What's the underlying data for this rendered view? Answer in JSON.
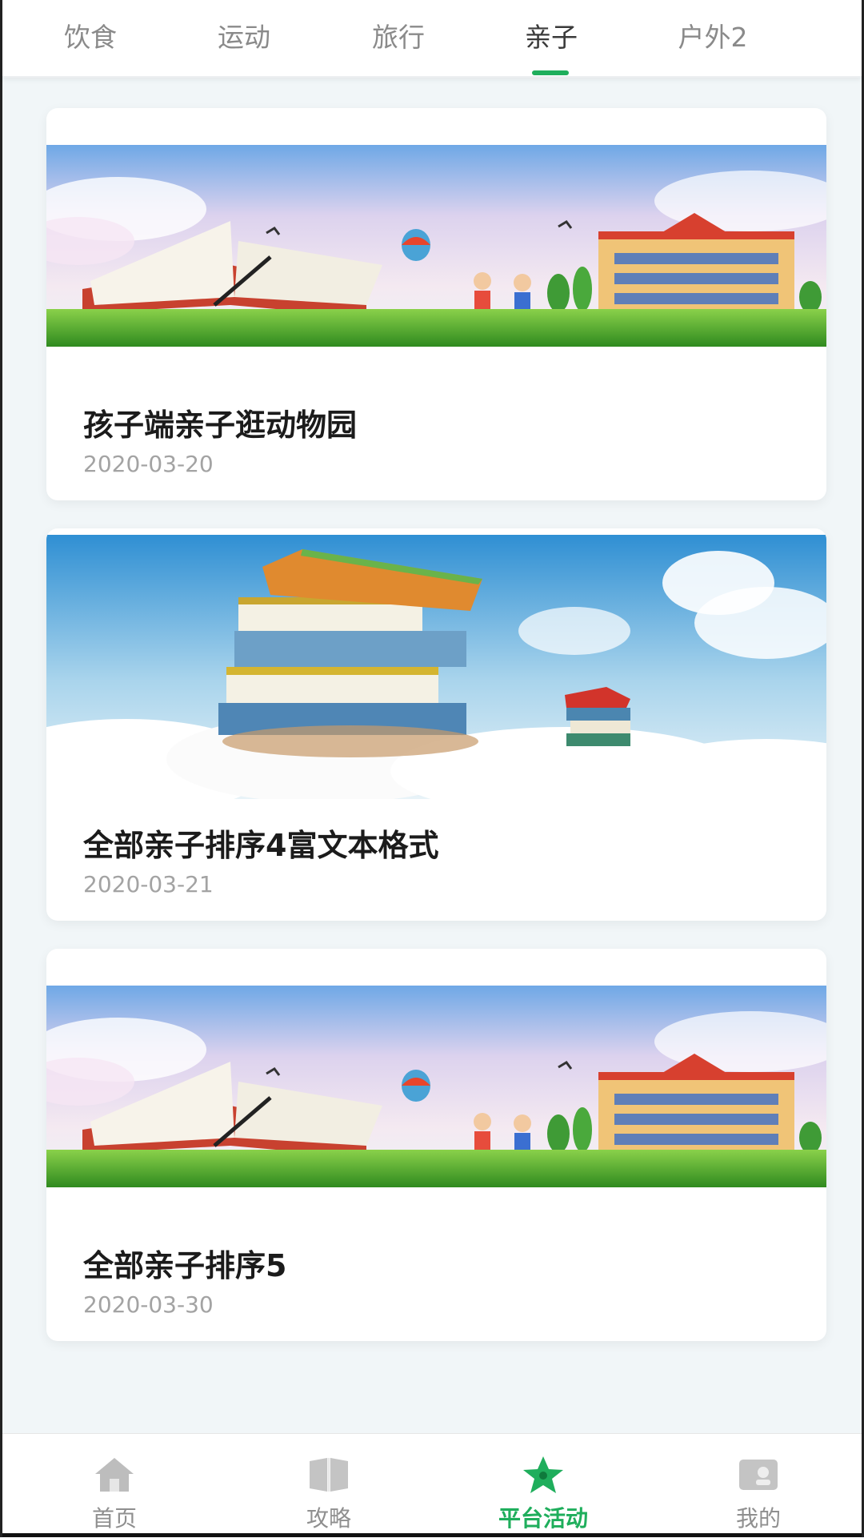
{
  "tabs": [
    {
      "label": "饮食"
    },
    {
      "label": "运动"
    },
    {
      "label": "旅行"
    },
    {
      "label": "亲子"
    },
    {
      "label": "户外2"
    }
  ],
  "active_tab": "亲子",
  "cards": [
    {
      "title": "孩子端亲子逛动物园",
      "date": "2020-03-20",
      "image": "school-meadow-banner"
    },
    {
      "title": "全部亲子排序4富文本格式",
      "date": "2020-03-21",
      "image": "book-stack-sky-banner"
    },
    {
      "title": "全部亲子排序5",
      "date": "2020-03-30",
      "image": "school-meadow-banner"
    }
  ],
  "bottom_nav": [
    {
      "label": "首页",
      "icon": "home-icon"
    },
    {
      "label": "攻略",
      "icon": "book-icon"
    },
    {
      "label": "平台活动",
      "icon": "star-icon"
    },
    {
      "label": "我的",
      "icon": "profile-card-icon"
    }
  ],
  "active_nav": "平台活动",
  "colors": {
    "accent": "#1fae5c",
    "background": "#f1f6f8"
  }
}
